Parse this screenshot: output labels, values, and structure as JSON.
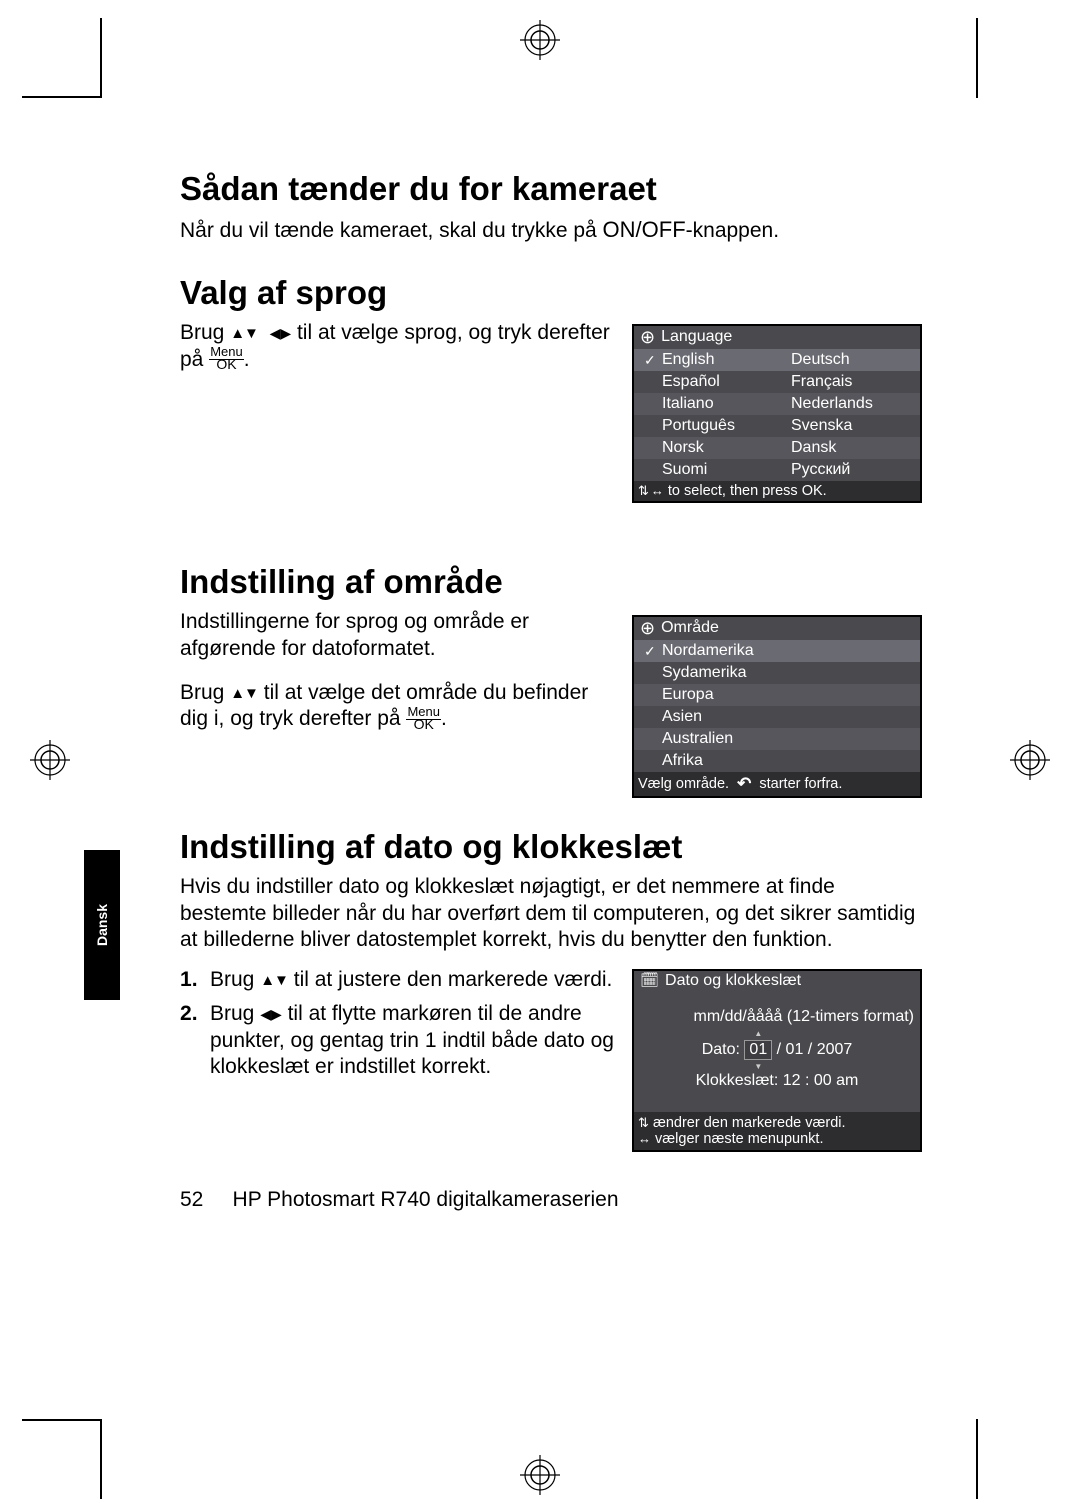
{
  "langTab": "Dansk",
  "s1": {
    "heading": "Sådan tænder du for kameraet",
    "text_a": "Når du vil tænde kameraet, skal du trykke på ",
    "onoff": "ON/OFF",
    "text_b": "-knappen."
  },
  "s2": {
    "heading": "Valg af sprog",
    "text_a": "Brug ",
    "text_b": " til at vælge sprog, og tryk derefter på ",
    "menu": "Menu",
    "ok": "OK",
    "screen": {
      "title": "Language",
      "rows": [
        {
          "left": "English",
          "right": "Deutsch",
          "checked": true
        },
        {
          "left": "Español",
          "right": "Français"
        },
        {
          "left": "Italiano",
          "right": "Nederlands"
        },
        {
          "left": "Português",
          "right": "Svenska"
        },
        {
          "left": "Norsk",
          "right": "Dansk"
        },
        {
          "left": "Suomi",
          "right": "Русский"
        }
      ],
      "footer": "to select, then press OK."
    }
  },
  "s3": {
    "heading": "Indstilling af område",
    "para1": "Indstillingerne for sprog og område er afgørende for datoformatet.",
    "para2a": "Brug ",
    "para2b": " til at vælge det område du befinder dig i, og tryk derefter på ",
    "menu": "Menu",
    "ok": "OK",
    "screen": {
      "title": "Område",
      "rows": [
        {
          "label": "Nordamerika",
          "checked": true
        },
        {
          "label": "Sydamerika"
        },
        {
          "label": "Europa"
        },
        {
          "label": "Asien"
        },
        {
          "label": "Australien"
        },
        {
          "label": "Afrika"
        }
      ],
      "footer_a": "Vælg område.",
      "footer_b": "starter forfra."
    }
  },
  "s4": {
    "heading": "Indstilling af dato og klokkeslæt",
    "para": "Hvis du indstiller dato og klokkeslæt nøjagtigt, er det nemmere at finde bestemte billeder når du har overført dem til computeren, og det sikrer samtidig at billederne bliver datostemplet korrekt, hvis du benytter den funktion.",
    "step1a": "Brug ",
    "step1b": " til at justere den markerede værdi.",
    "step2a": "Brug ",
    "step2b": " til at flytte markøren til de andre punkter, og gentag trin 1 indtil både dato og klokkeslæt er indstillet korrekt.",
    "screen": {
      "title": "Dato og klokkeslæt",
      "format": "mm/dd/åååå (12-timers format)",
      "date_label": "Dato:",
      "date_sel": "01",
      "date_rest": " / 01 / 2007",
      "time_label": "Klokkeslæt:",
      "time_val": "  12 : 00  am",
      "footer1": "ændrer den markerede værdi.",
      "footer2": "vælger næste menupunkt."
    }
  },
  "footer": {
    "page": "52",
    "title": "HP Photosmart R740 digitalkameraserien"
  }
}
